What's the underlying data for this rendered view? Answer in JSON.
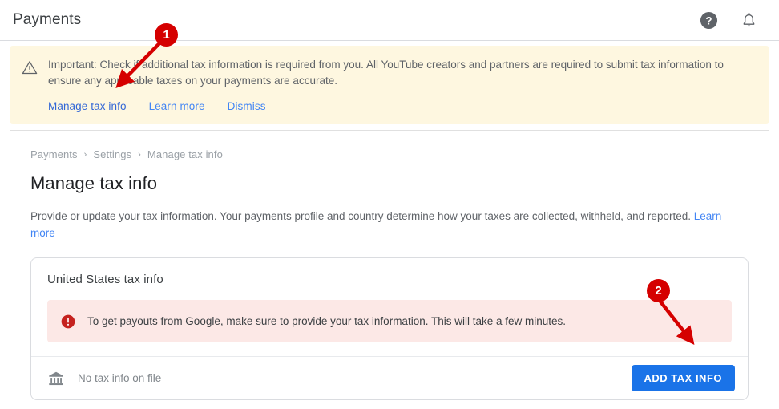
{
  "header": {
    "title": "Payments",
    "help_icon": "help-circle-icon",
    "notifications_icon": "bell-icon"
  },
  "banner": {
    "icon": "warning-triangle-icon",
    "text": "Important: Check if additional tax information is required from you. All YouTube creators and partners are required to submit tax information to ensure any applicable taxes on your payments are accurate.",
    "actions": [
      {
        "label": "Manage tax info"
      },
      {
        "label": "Learn more"
      },
      {
        "label": "Dismiss"
      }
    ],
    "background_color": "#fef7e0",
    "link_color": "#4285f4"
  },
  "breadcrumb": [
    {
      "label": "Payments"
    },
    {
      "label": "Settings"
    },
    {
      "label": "Manage tax info"
    }
  ],
  "breadcrumb_separator": "›",
  "page": {
    "title": "Manage tax info",
    "description": "Provide or update your tax information. Your payments profile and country determine how your taxes are collected, withheld, and reported. ",
    "description_link": "Learn more"
  },
  "card": {
    "title": "United States tax info",
    "alert": {
      "icon": "error-circle-icon",
      "text": "To get payouts from Google, make sure to provide your tax information. This will take a few minutes.",
      "background_color": "#fce8e6",
      "icon_color": "#c5221f"
    },
    "footer": {
      "icon": "bank-icon",
      "status": "No tax info on file",
      "button_label": "ADD TAX INFO",
      "button_color": "#1a73e8"
    }
  },
  "annotations": {
    "marker_color": "#d50000",
    "markers": [
      {
        "label": "1"
      },
      {
        "label": "2"
      }
    ]
  }
}
